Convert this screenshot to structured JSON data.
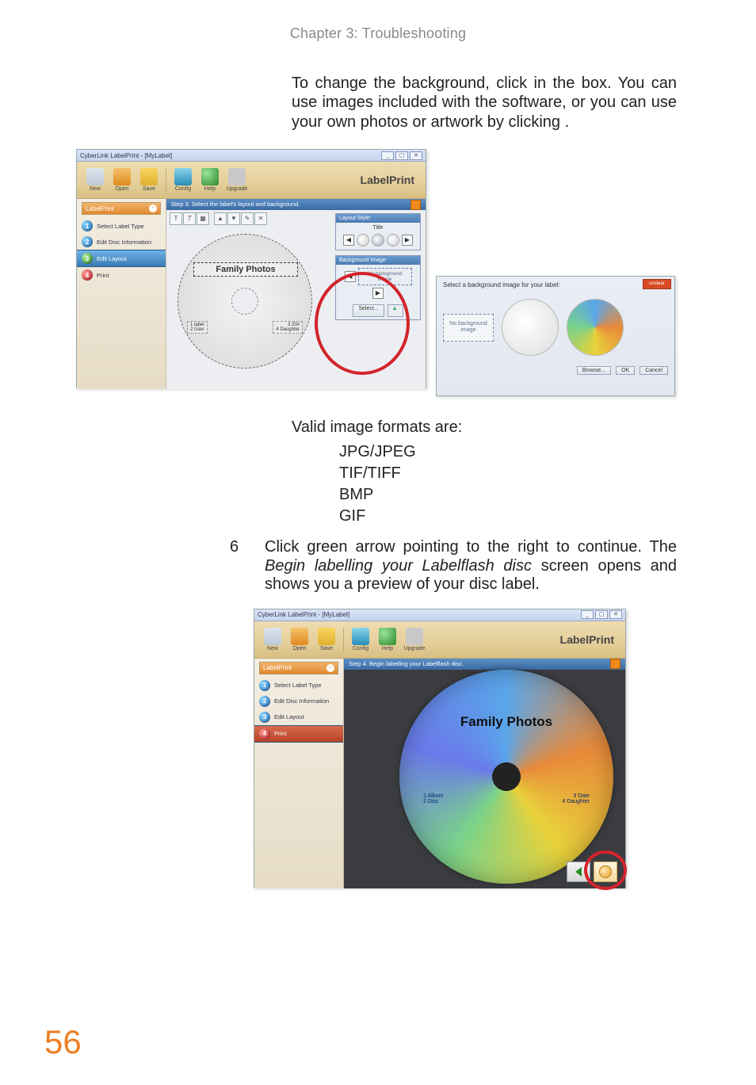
{
  "chapter_header": "Chapter 3: Troubleshooting",
  "para1_pre": "To change the background, click ",
  "para1_mid": " in the ",
  "para1_post": " box. You can use images included with the software, or you can use your own photos or artwork by clicking ",
  "para1_end": ".",
  "labelprint_word": "LabelPrint",
  "window_title": "CyberLink LabelPrint - [MyLabel]",
  "toolbar": {
    "new": "New",
    "open": "Open",
    "save": "Save",
    "config": "Config",
    "help": "Help",
    "upgrade": "Upgrade"
  },
  "sidebar": {
    "title": "LabelPrint",
    "steps": [
      "Select Label Type",
      "Edit Disc Information",
      "Edit Layout",
      "Print"
    ]
  },
  "stepbar3": "Step 3. Select the label's layout and background.",
  "stepbar4": "Step 4. Begin labelling your Labelflash disc.",
  "disc": {
    "title": "Family Photos",
    "meta_left_1": "1  label",
    "meta_left_2": "2  User",
    "meta_right_1": "3  20#",
    "meta_right_2": "4  Daughter"
  },
  "panels": {
    "layout_title": "Layout Style:",
    "title_label": "Title",
    "bg_title": "Background Image:",
    "bg_none": "No background image",
    "select_btn": "Select..."
  },
  "dialog": {
    "label": "Select a background image for your label:",
    "no_bg": "No background image",
    "help_tag": "unclear",
    "browse": "Browse...",
    "ok": "OK",
    "cancel": "Cancel"
  },
  "formats": {
    "lead": "Valid image formats are:",
    "list": [
      "JPG/JPEG",
      "TIF/TIFF",
      "BMP",
      "GIF"
    ]
  },
  "step6": {
    "num": "6",
    "pre": "Click green arrow pointing to the right to continue. The ",
    "ital": "Begin labelling your Labelflash disc",
    "post": " screen opens and shows you a preview of your disc label."
  },
  "preview_meta": {
    "left_1": "1  Album",
    "left_2": "2  Disc",
    "right_1": "3  Date",
    "right_2": "4  Daughter"
  },
  "page_number": "56"
}
